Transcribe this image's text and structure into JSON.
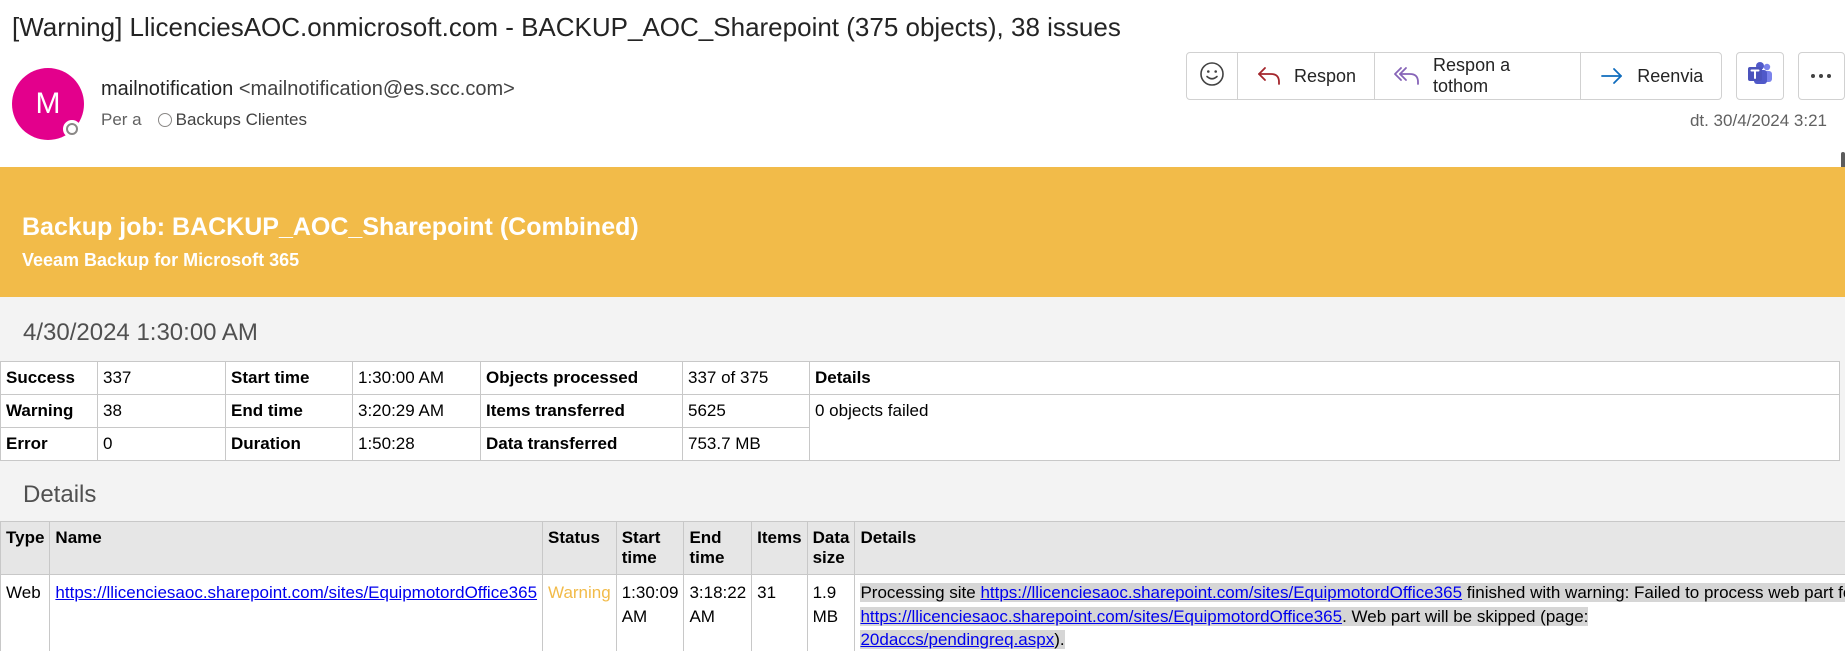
{
  "email": {
    "subject": "[Warning] LlicenciesAOC.onmicrosoft.com - BACKUP_AOC_Sharepoint (375 objects), 38 issues",
    "avatar_letter": "M",
    "sender_name": "mailnotification",
    "sender_email": "<mailnotification@es.scc.com>",
    "to_label": "Per a",
    "recipient": "Backups Clientes",
    "date": "dt. 30/4/2024 3:21",
    "accent_color": "#e3008c"
  },
  "toolbar": {
    "emoji_icon": "smiley-icon",
    "reply_label": "Respon",
    "reply_all_label": "Respon a tothom",
    "forward_label": "Reenvia",
    "teams_icon": "teams-icon",
    "more_icon": "more-icon"
  },
  "report": {
    "banner_color": "#f2bb49",
    "title": "Backup job: BACKUP_AOC_Sharepoint (Combined)",
    "subtitle": "Veeam Backup for Microsoft 365",
    "run_date": "4/30/2024 1:30:00 AM",
    "summary": {
      "success_label": "Success",
      "success_value": "337",
      "warning_label": "Warning",
      "warning_value": "38",
      "error_label": "Error",
      "error_value": "0",
      "start_label": "Start time",
      "start_value": "1:30:00 AM",
      "end_label": "End time",
      "end_value": "3:20:29 AM",
      "duration_label": "Duration",
      "duration_value": "1:50:28",
      "objects_label": "Objects processed",
      "objects_value": "337 of 375",
      "items_label": "Items transferred",
      "items_value": "5625",
      "data_label": "Data transferred",
      "data_value": "753.7 MB",
      "details_label": "Details",
      "details_value": "0 objects failed"
    },
    "details_title": "Details",
    "columns": {
      "type": "Type",
      "name": "Name",
      "status": "Status",
      "start": "Start time",
      "end": "End time",
      "items": "Items",
      "size": "Data size",
      "details": "Details"
    },
    "rows": [
      {
        "type": "Web",
        "name": "https://llicenciesaoc.sharepoint.com/sites/EquipmotordOffice365",
        "status": "Warning",
        "start": "1:30:09 AM",
        "end": "3:18:22 AM",
        "items": "31",
        "size": "1.9 MB",
        "details_prefix": "Processing site ",
        "details_link1": "https://llicenciesaoc.sharepoint.com/sites/EquipmotordOffice365",
        "details_mid": " finished with warning: Failed to process web part for page",
        "details_link2": "https://llicenciesaoc.sharepoint.com/sites/EquipmotordOffice365",
        "details_mid2": ". Web part will be skipped (page: ",
        "details_link3": "20daccs/pendingreq.aspx",
        "details_end": ")."
      }
    ]
  }
}
